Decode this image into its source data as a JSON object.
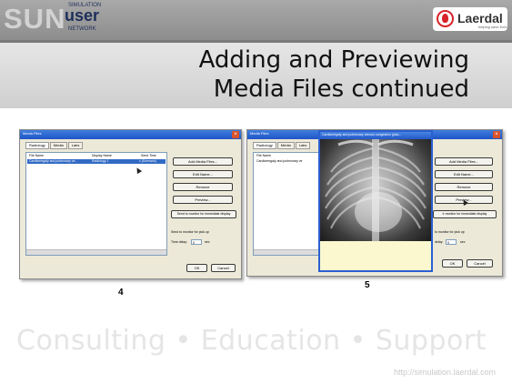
{
  "header": {
    "logo_letters": "SUN",
    "logo_small_top": "SIMULATION",
    "logo_user": "user",
    "logo_small_bottom": "NETWORK",
    "brand_name": "Laerdal",
    "brand_tagline": "helping save lives"
  },
  "slide": {
    "title_line1": "Adding and Previewing",
    "title_line2": "Media Files continued"
  },
  "screenshot1": {
    "window_title": "Media Files",
    "tabs": [
      "Radiology",
      "Media",
      "Labs"
    ],
    "columns": [
      "File Name",
      "Display Name",
      "Send Time"
    ],
    "row": {
      "file": "Cardiomegaly and pulmonary ve...",
      "display": "Radiology 1",
      "time": "x (Scenario)"
    },
    "buttons": [
      "Add Media Files...",
      "Edit Name...",
      "Remove",
      "Preview...",
      "Send to monitor for immediate display"
    ],
    "send_label": "Send to monitor for pick up",
    "delay_label": "Time delay:",
    "delay_value": "0",
    "delay_unit": "sec",
    "ok": "OK",
    "cancel": "Cancel",
    "figure_number": "4"
  },
  "screenshot2": {
    "window_title": "Media Files",
    "tabs": [
      "Radiology",
      "Media",
      "Labs"
    ],
    "column": "File Name",
    "row": "Cardiomegaly and pulmonary ve",
    "preview_title": "Cardiomegaly and pulmonary venous congestion (plac...",
    "buttons": [
      "Add Media Files...",
      "Edit Name...",
      "Remove",
      "Preview...",
      "ir monitor for immediate display"
    ],
    "send_label": "to monitor for pick up",
    "delay_label": "delay:",
    "delay_value": "0",
    "delay_unit": "sec",
    "ok": "OK",
    "cancel": "Cancel",
    "figure_number": "5"
  },
  "footer": {
    "tagline": "Consulting  •  Education  •  Support",
    "url": "http://simulation.laerdal.com"
  }
}
